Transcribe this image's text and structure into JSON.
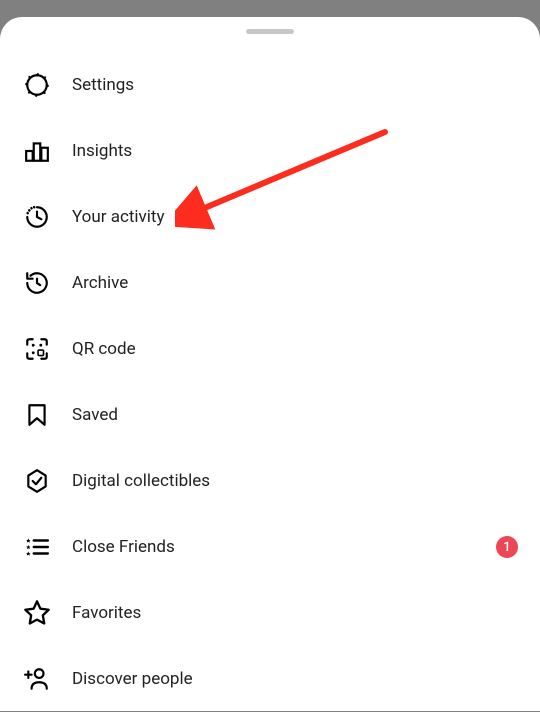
{
  "menu": {
    "items": [
      {
        "key": "settings",
        "label": "Settings",
        "icon": "settings-icon"
      },
      {
        "key": "insights",
        "label": "Insights",
        "icon": "insights-icon"
      },
      {
        "key": "your-activity",
        "label": "Your activity",
        "icon": "activity-icon"
      },
      {
        "key": "archive",
        "label": "Archive",
        "icon": "archive-icon"
      },
      {
        "key": "qr-code",
        "label": "QR code",
        "icon": "qrcode-icon"
      },
      {
        "key": "saved",
        "label": "Saved",
        "icon": "saved-icon"
      },
      {
        "key": "digital-collectibles",
        "label": "Digital collectibles",
        "icon": "collectibles-icon"
      },
      {
        "key": "close-friends",
        "label": "Close Friends",
        "icon": "closefriends-icon",
        "badge": "1"
      },
      {
        "key": "favorites",
        "label": "Favorites",
        "icon": "favorites-icon"
      },
      {
        "key": "discover-people",
        "label": "Discover people",
        "icon": "discover-icon"
      }
    ]
  },
  "annotation": {
    "arrow_color": "#fc2c1e",
    "target": "your-activity"
  }
}
